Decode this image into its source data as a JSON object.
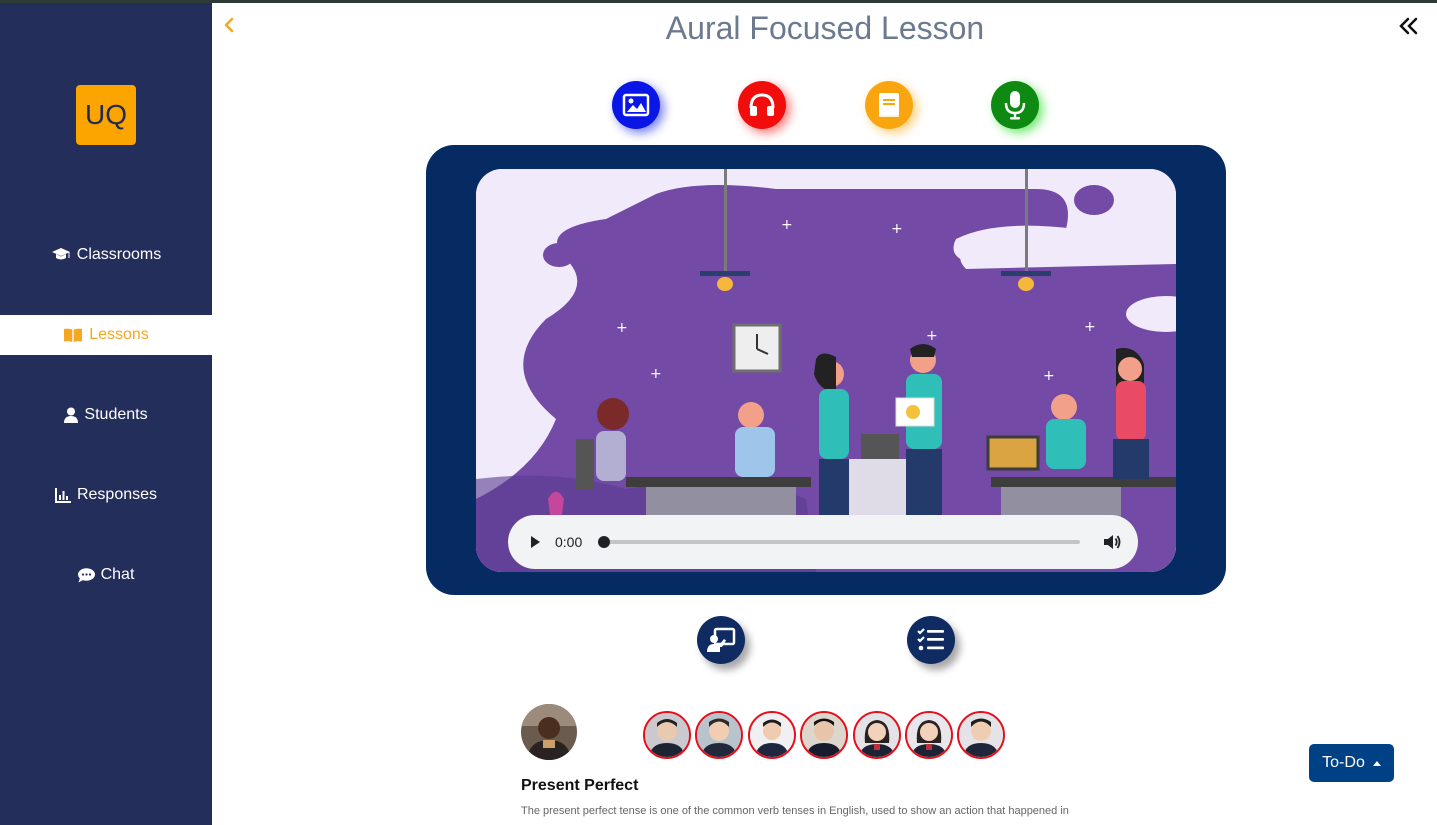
{
  "app": {
    "logo_text": "UQ",
    "accent_color": "#f5a623",
    "sidebar_color": "#242e5a"
  },
  "sidebar": {
    "items": [
      {
        "label": "Classrooms",
        "icon": "graduation-cap-icon",
        "active": false
      },
      {
        "label": "Lessons",
        "icon": "open-book-icon",
        "active": true
      },
      {
        "label": "Students",
        "icon": "user-icon",
        "active": false
      },
      {
        "label": "Responses",
        "icon": "bar-chart-icon",
        "active": false
      },
      {
        "label": "Chat",
        "icon": "chat-bubble-icon",
        "active": false
      }
    ]
  },
  "header": {
    "title": "Aural Focused Lesson",
    "back_icon": "chevron-left-icon",
    "collapse_icon": "double-chevron-left-icon"
  },
  "modes": [
    {
      "name": "image",
      "icon": "image-icon",
      "color": "#0a16e6"
    },
    {
      "name": "audio",
      "icon": "headphones-icon",
      "color": "#f20d0d"
    },
    {
      "name": "reading",
      "icon": "book-icon",
      "color": "#f9a50f"
    },
    {
      "name": "speaking",
      "icon": "microphone-icon",
      "color": "#0e8a12"
    }
  ],
  "player": {
    "time": "0:00",
    "progress": 0
  },
  "actions": [
    {
      "name": "presentation",
      "icon": "presentation-icon"
    },
    {
      "name": "checklist",
      "icon": "checklist-icon"
    }
  ],
  "participants": {
    "teacher_count": 1,
    "student_count": 7
  },
  "lesson": {
    "title": "Present Perfect",
    "description": "The present perfect tense is one of the common verb tenses in English, used to show an action that happened in"
  },
  "todo": {
    "label": "To-Do"
  }
}
